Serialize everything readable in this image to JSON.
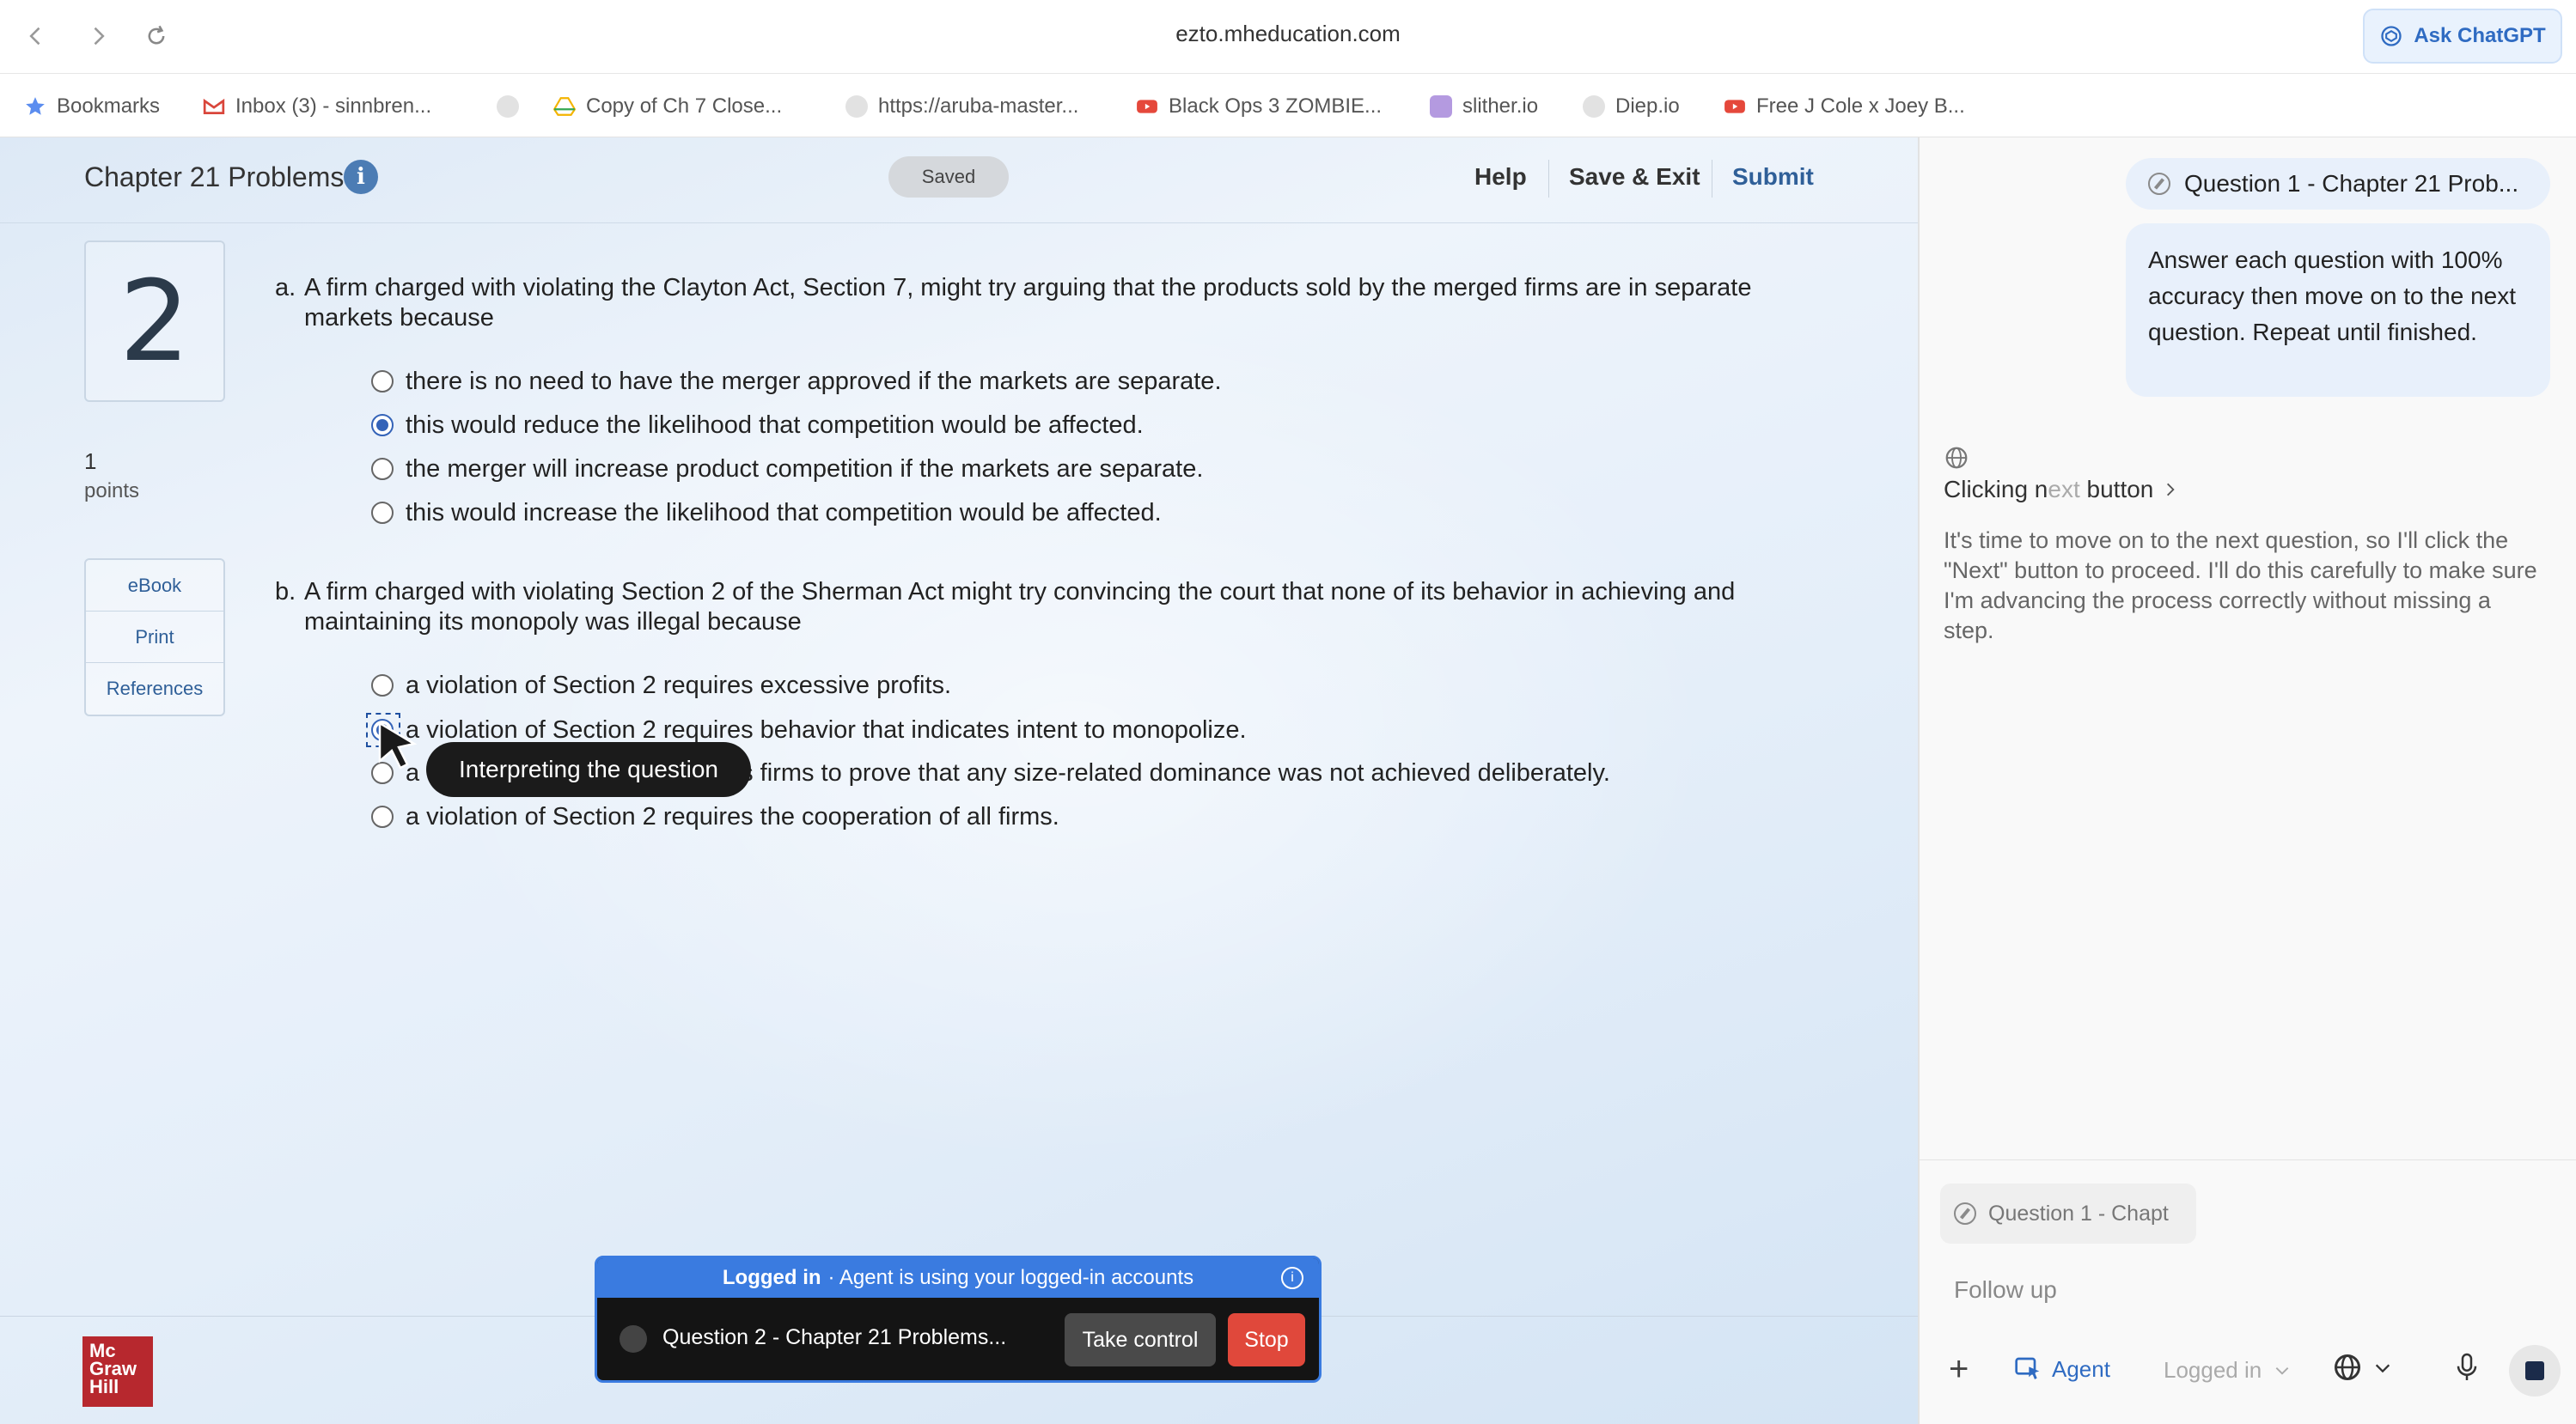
{
  "browser": {
    "url": "ezto.mheducation.com",
    "ask_chatgpt": "Ask ChatGPT"
  },
  "bookmarks": [
    {
      "label": "Bookmarks",
      "icon": "star-icon",
      "color": "#5b8def"
    },
    {
      "label": "Inbox (3) - sinnbren...",
      "icon": "gmail-icon",
      "color": "#d9463b"
    },
    {
      "label": "",
      "icon": "blank-favicon",
      "color": "#d8d8d8"
    },
    {
      "label": "Copy of Ch 7 Close...",
      "icon": "drive-icon",
      "color": "#f4b400"
    },
    {
      "label": "https://aruba-master...",
      "icon": "globe-favicon",
      "color": "#d8d8d8"
    },
    {
      "label": "Black Ops 3 ZOMBIE...",
      "icon": "youtube-icon",
      "color": "#e5483b"
    },
    {
      "label": "slither.io",
      "icon": "slither-icon",
      "color": "#9a7ed1"
    },
    {
      "label": "Diep.io",
      "icon": "globe-favicon",
      "color": "#d8d8d8"
    },
    {
      "label": "Free J Cole x Joey B...",
      "icon": "youtube-icon",
      "color": "#e5483b"
    }
  ],
  "assignment": {
    "title": "Chapter 21 Problems",
    "saved": "Saved",
    "help": "Help",
    "save_exit": "Save & Exit",
    "submit": "Submit"
  },
  "question": {
    "number": "2",
    "points_value": "1",
    "points_label": "points",
    "tools": [
      "eBook",
      "Print",
      "References"
    ]
  },
  "part_a": {
    "label": "a.",
    "text": "A firm charged with violating the Clayton Act, Section 7, might try arguing that the products sold by the merged firms are in separate markets because",
    "options": [
      "there is no need to have the merger approved if the markets are separate.",
      "this would reduce the likelihood that competition would be affected.",
      "the merger will increase product competition if the markets are separate.",
      "this would increase the likelihood that competition would be affected."
    ],
    "selected": 1
  },
  "part_b": {
    "label": "b.",
    "text": "A firm charged with violating Section 2 of the Sherman Act might try convincing the court that none of its behavior in achieving and maintaining its monopoly was illegal because",
    "options": [
      "a violation of Section 2 requires excessive profits.",
      "a violation of Section 2 requires behavior that indicates intent to monopolize.",
      "a violation of Section 2 requires firms to prove that any size-related dominance was not achieved deliberately.",
      "a violation of Section 2 requires the cooperation of all firms."
    ],
    "selected": 1
  },
  "tooltip": "Interpreting the question",
  "logo": [
    "Mc",
    "Graw",
    "Hill"
  ],
  "agent_bar": {
    "status_bold": "Logged in",
    "status_text": "· Agent is using your logged-in accounts",
    "task": "Question 2 - Chapter 21 Problems...",
    "take_control": "Take control",
    "stop": "Stop"
  },
  "chat": {
    "question_chip": "Question 1 - Chapter 21 Prob...",
    "user_message": "Answer each question with 100% accuracy then move on to the next question. Repeat until finished.",
    "step_title_main": "Clicking n",
    "step_title_dim": "ext",
    "step_title_end": " button",
    "step_body": "It's time to move on to the next question, so I'll click the \"Next\" button to proceed. I'll do this carefully to make sure I'm advancing the process correctly without missing a step.",
    "context_chip": "Question 1 - Chapt",
    "followup_placeholder": "Follow up",
    "agent_label": "Agent",
    "logged_in_label": "Logged in"
  },
  "colors": {
    "accent": "#3a7be0",
    "stop": "#e0483b",
    "radio_selected": "#3463b8",
    "logo": "#b7282e"
  }
}
